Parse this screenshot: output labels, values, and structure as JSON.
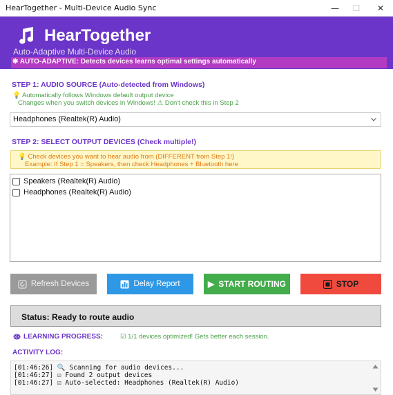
{
  "window": {
    "title": "HearTogether - Multi-Device Audio Sync",
    "minimize": "—",
    "maximize": "☐",
    "close": "✕"
  },
  "header": {
    "app_name": "HearTogether",
    "tagline": "Auto-Adaptive Multi-Device Audio",
    "banner": "✱ AUTO-ADAPTIVE: Detects devices  learns optimal settings automatically",
    "brand_color": "#6b35c9",
    "banner_color": "#b23bc1",
    "logo_icon": "music-note-icon"
  },
  "step1": {
    "label": "STEP 1: AUDIO SOURCE (Auto-detected from Windows)",
    "hint1": "💡 Automatically follows Windows default output device",
    "hint2": "Changes when you switch devices in Windows! ⚠ Don't check this in Step 2",
    "selected_device": "Headphones (Realtek(R) Audio)"
  },
  "step2": {
    "label": "STEP 2: SELECT OUTPUT DEVICES (Check multiple!)",
    "warn1": "💡 Check devices you want to hear audio from (DIFFERENT from Step 1!)",
    "warn2": "Example: If Step 1 = Speakers, then check Headphones + Bluetooth here",
    "devices": [
      {
        "label": "Speakers (Realtek(R) Audio)",
        "checked": false
      },
      {
        "label": "Headphones (Realtek(R) Audio)",
        "checked": false
      }
    ]
  },
  "buttons": {
    "refresh": "Refresh Devices",
    "delay": "Delay Report",
    "start": "START ROUTING",
    "stop": "STOP",
    "start_icon": "▶"
  },
  "status": {
    "text": "Status: Ready to route audio"
  },
  "learning": {
    "label": "LEARNING PROGRESS:",
    "value": "☑ 1/1 devices optimized! Gets better each session."
  },
  "log": {
    "label": "ACTIVITY LOG:",
    "lines": [
      "[01:46:26] 🔍 Scanning for audio devices...",
      "[01:46:27] ☑ Found 2 output devices",
      "[01:46:27] ☑ Auto-selected: Headphones (Realtek(R) Audio)"
    ]
  }
}
